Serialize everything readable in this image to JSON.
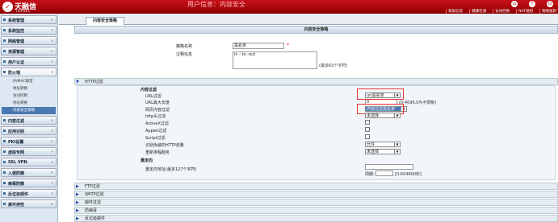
{
  "app": {
    "logo_text": "天融信",
    "logo_sub": "TOPSEC",
    "user_title": "用户信息：内容安全"
  },
  "top_menu": [
    "帮助信息",
    "健康检测",
    "访问控制",
    "NAT规则",
    "策略规则"
  ],
  "sidebar": {
    "items": [
      {
        "label": "系统管理"
      },
      {
        "label": "系统监控"
      },
      {
        "label": "网络管理"
      },
      {
        "label": "资源管理"
      },
      {
        "label": "用户认证"
      },
      {
        "label": "防火墙",
        "open": true,
        "children": [
          "IP/MAC绑定",
          "地址转换",
          "访问控制",
          "地址转换",
          "内容安全策略"
        ],
        "active_child": 4
      },
      {
        "label": "内容过滤"
      },
      {
        "label": "应用识别"
      },
      {
        "label": "PKI设置"
      },
      {
        "label": "虚拟专网"
      },
      {
        "label": "SSL VPN"
      },
      {
        "label": "入侵防御"
      },
      {
        "label": "病毒防御"
      },
      {
        "label": "反垃圾邮件"
      },
      {
        "label": "高可用性"
      }
    ]
  },
  "tab": {
    "label": "内容安全策略"
  },
  "form": {
    "header": "内容安全策略",
    "name_label": "策略名称",
    "name_value": "黑名单",
    "required": "*",
    "comment_label": "注释信息",
    "comment_value": "in - to -out",
    "comment_note": "(最多63个字符)"
  },
  "http": {
    "section_label": "HTTP过滤",
    "sub_title": "内容过滤",
    "rows": [
      {
        "label": "URL过滤",
        "type": "select",
        "value": "url黑名单"
      },
      {
        "label": "URL最大长度",
        "type": "input",
        "value": "0",
        "note": "(0-4096,0为不限制)"
      },
      {
        "label": "网页内容过滤",
        "type": "select",
        "value": "内容过滤黑名单"
      },
      {
        "label": "http头过滤",
        "type": "select",
        "value": "未选择"
      },
      {
        "label": "ActiveX过滤",
        "type": "checkbox"
      },
      {
        "label": "Applet过滤",
        "type": "checkbox"
      },
      {
        "label": "Script过滤",
        "type": "checkbox"
      },
      {
        "label": "识别伪装的HTTP流量",
        "type": "select",
        "value": "允许"
      },
      {
        "label": "重新排程服务",
        "type": "select",
        "value": "未选择"
      }
    ],
    "redirect_title": "重定向",
    "redirect_label": "重定向地址(最多127个字符)",
    "cycle_label": "周期：",
    "cycle_note": "[0-604800秒]"
  },
  "collapsed": [
    "FTP过滤",
    "SMTP过滤",
    "邮件过滤",
    "防病毒",
    "反垃圾邮件"
  ]
}
